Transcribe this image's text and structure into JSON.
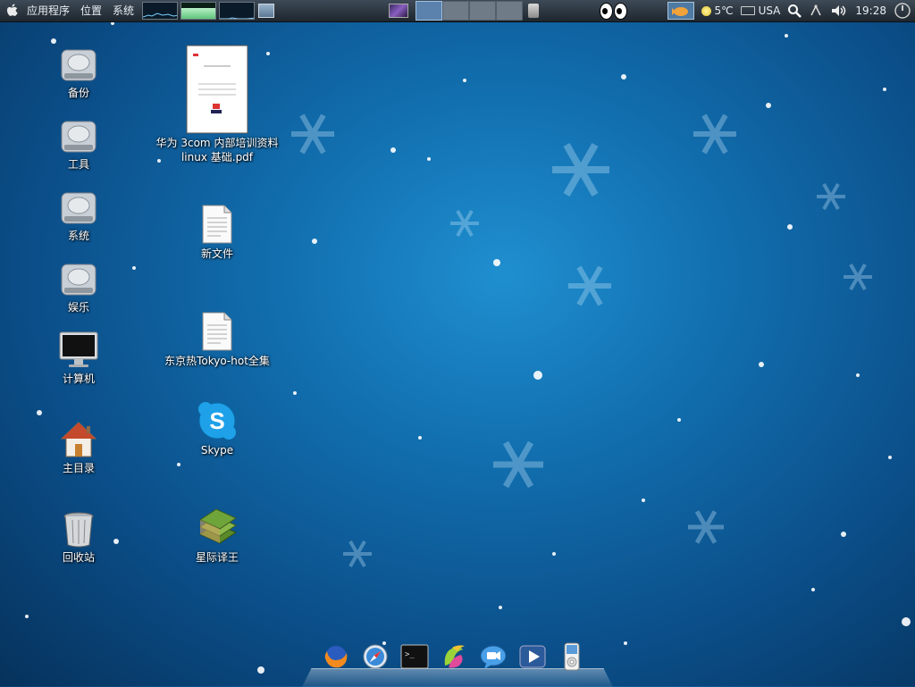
{
  "panel": {
    "menu": [
      "应用程序",
      "位置",
      "系统"
    ],
    "tray": {
      "weather": "5℃",
      "keyboard": "USA",
      "clock": "19:28"
    }
  },
  "desktop": {
    "left_column": [
      {
        "label": "备份",
        "icon": "drive-icon"
      },
      {
        "label": "工具",
        "icon": "drive-icon"
      },
      {
        "label": "系统",
        "icon": "drive-icon"
      },
      {
        "label": "娱乐",
        "icon": "drive-icon"
      },
      {
        "label": "计算机",
        "icon": "computer-icon"
      },
      {
        "label": "主目录",
        "icon": "home-icon"
      },
      {
        "label": "回收站",
        "icon": "trash-icon"
      }
    ],
    "right_column": [
      {
        "label": "华为 3com 内部培训资料linux 基础.pdf",
        "icon": "pdf-icon"
      },
      {
        "label": "新文件",
        "icon": "text-file-icon"
      },
      {
        "label": "东京热Tokyo-hot全集",
        "icon": "text-file-icon"
      },
      {
        "label": "Skype",
        "icon": "skype-icon"
      },
      {
        "label": "星际译王",
        "icon": "dictionary-icon"
      }
    ]
  },
  "dock": {
    "apps": [
      "firefox-icon",
      "safari-compass-icon",
      "terminal-icon",
      "pidgin-icon",
      "video-chat-icon",
      "media-player-icon",
      "ipod-icon"
    ]
  },
  "colors": {
    "panel_bg": "#2a333d",
    "desktop_bg": "#1270b0",
    "workspace_active": "#5b82ad"
  }
}
